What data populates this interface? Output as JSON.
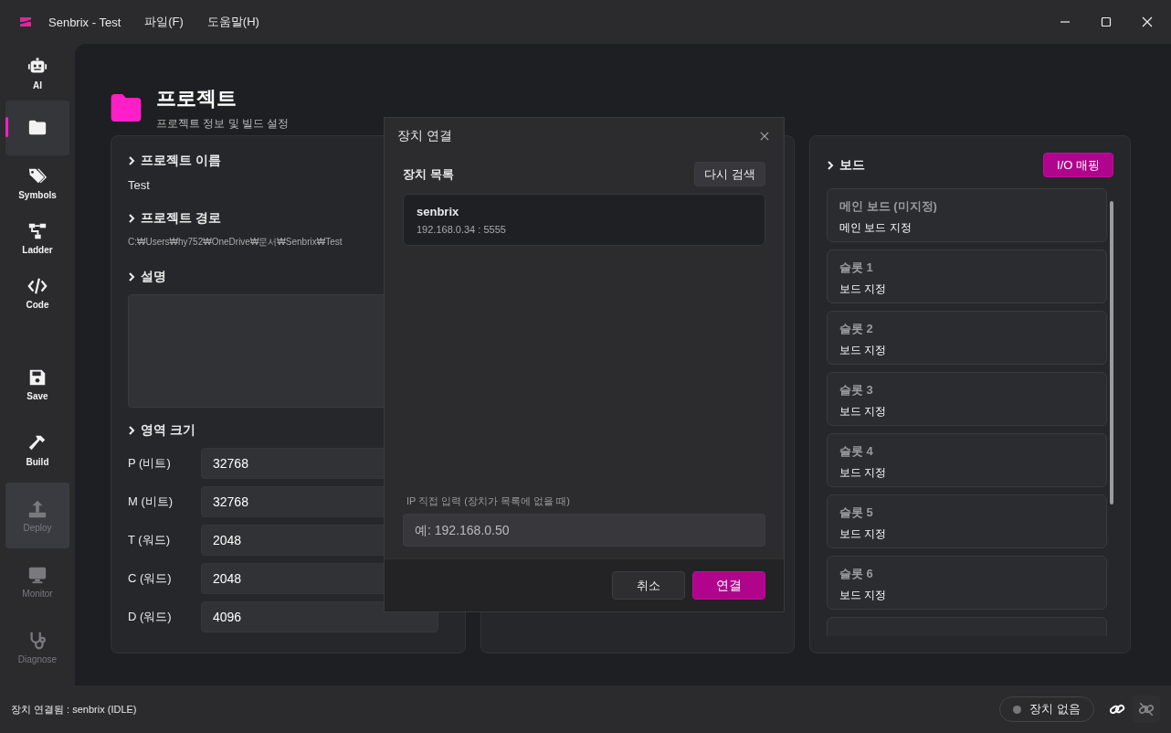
{
  "window": {
    "title": "Senbrix - Test",
    "menu": [
      "파일(F)",
      "도움말(H)"
    ]
  },
  "sidebar": {
    "tools": [
      {
        "label": "AI",
        "selected": false,
        "disabled": false,
        "hovered": false
      },
      {
        "selected": true,
        "disabled": false,
        "hovered": false
      },
      {
        "label": "Symbols",
        "selected": false,
        "disabled": false,
        "hovered": false
      },
      {
        "label": "Ladder",
        "selected": false,
        "disabled": false,
        "hovered": false
      },
      {
        "label": "Code",
        "selected": false,
        "disabled": false,
        "hovered": false
      }
    ],
    "actions": [
      {
        "label": "Save",
        "selected": false,
        "disabled": false,
        "hovered": false
      },
      {
        "label": "Build",
        "selected": false,
        "disabled": false,
        "hovered": false
      },
      {
        "label": "Deploy",
        "selected": false,
        "disabled": true,
        "hovered": true
      },
      {
        "label": "Monitor",
        "selected": false,
        "disabled": true,
        "hovered": false
      },
      {
        "label": "Diagnose",
        "selected": false,
        "disabled": true,
        "hovered": false
      }
    ]
  },
  "page": {
    "title": "프로젝트",
    "subtitle": "프로젝트 정보 및 빌드 설정"
  },
  "project": {
    "name_heading": "프로젝트 이름",
    "name": "Test",
    "path_heading": "프로젝트 경로",
    "path": "C:₩Users₩hy752₩OneDrive₩문서₩Senbrix₩Test",
    "description_heading": "설명",
    "memory_heading": "영역 크기",
    "memory": [
      {
        "label": "P (비트)",
        "value": "32768"
      },
      {
        "label": "M (비트)",
        "value": "32768"
      },
      {
        "label": "T (워드)",
        "value": "2048"
      },
      {
        "label": "C (워드)",
        "value": "2048"
      },
      {
        "label": "D (워드)",
        "value": "4096"
      }
    ]
  },
  "board": {
    "heading": "보드",
    "mapping_button": "I/O 매핑",
    "slots": [
      {
        "title": "메인 보드 (미지정)",
        "action": "메인 보드 지정"
      },
      {
        "title": "슬롯 1",
        "action": "보드 지정"
      },
      {
        "title": "슬롯 2",
        "action": "보드 지정"
      },
      {
        "title": "슬롯 3",
        "action": "보드 지정"
      },
      {
        "title": "슬롯 4",
        "action": "보드 지정"
      },
      {
        "title": "슬롯 5",
        "action": "보드 지정"
      },
      {
        "title": "슬롯 6",
        "action": "보드 지정"
      }
    ]
  },
  "dialog": {
    "title": "장치 연결",
    "list_label": "장치 목록",
    "rescan_button": "다시 검색",
    "devices": [
      {
        "name": "senbrix",
        "address": "192.168.0.34 : 5555"
      }
    ],
    "ip_label": "IP 직접 입력 (장치가 목록에 없을 때)",
    "ip_placeholder": "예: 192.168.0.50",
    "cancel_button": "취소",
    "connect_button": "연결"
  },
  "status_bar": {
    "text": "장치 연결됨 : senbrix (IDLE)",
    "device_pill": "장치 없음"
  }
}
